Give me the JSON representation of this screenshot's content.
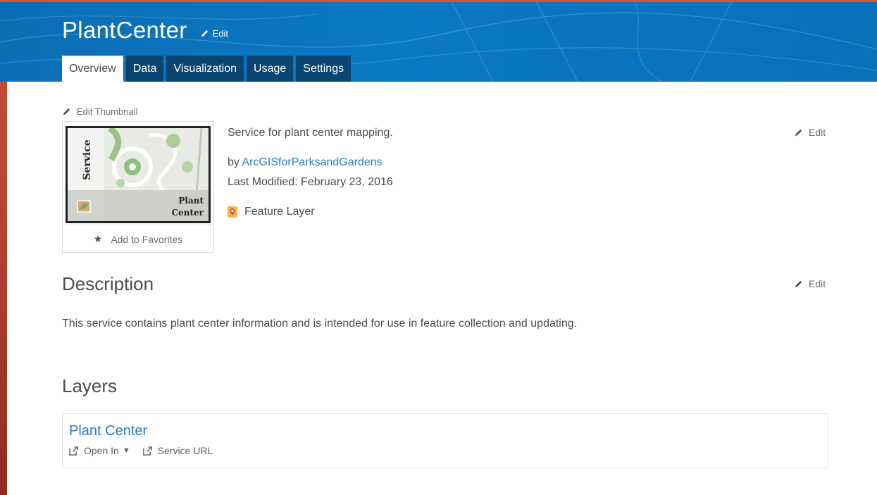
{
  "header": {
    "title": "PlantCenter",
    "edit_label": "Edit",
    "tabs": [
      {
        "label": "Overview",
        "active": true
      },
      {
        "label": "Data",
        "active": false
      },
      {
        "label": "Visualization",
        "active": false
      },
      {
        "label": "Usage",
        "active": false
      },
      {
        "label": "Settings",
        "active": false
      }
    ]
  },
  "thumbnail": {
    "edit_label": "Edit Thumbnail",
    "text_vertical": "Service",
    "text_line1": "Plant",
    "text_line2": "Center",
    "favorite_label": "Add to Favorites"
  },
  "summary": {
    "text": "Service for plant center mapping.",
    "by_prefix": "by",
    "owner": "ArcGISforParksandGardens",
    "modified": "Last Modified: February 23, 2016",
    "item_type": "Feature Layer",
    "edit_label": "Edit"
  },
  "description": {
    "heading": "Description",
    "text": "This service contains plant center information and is intended for use in feature collection and updating.",
    "edit_label": "Edit"
  },
  "layers": {
    "heading": "Layers",
    "items": [
      {
        "name": "Plant Center",
        "open_in_label": "Open In",
        "service_url_label": "Service URL"
      }
    ]
  },
  "colors": {
    "header_blue": "#0a79c4",
    "tab_dark": "#0a4470",
    "link_blue": "#2e7bbf",
    "accent_red": "#d6523d"
  }
}
